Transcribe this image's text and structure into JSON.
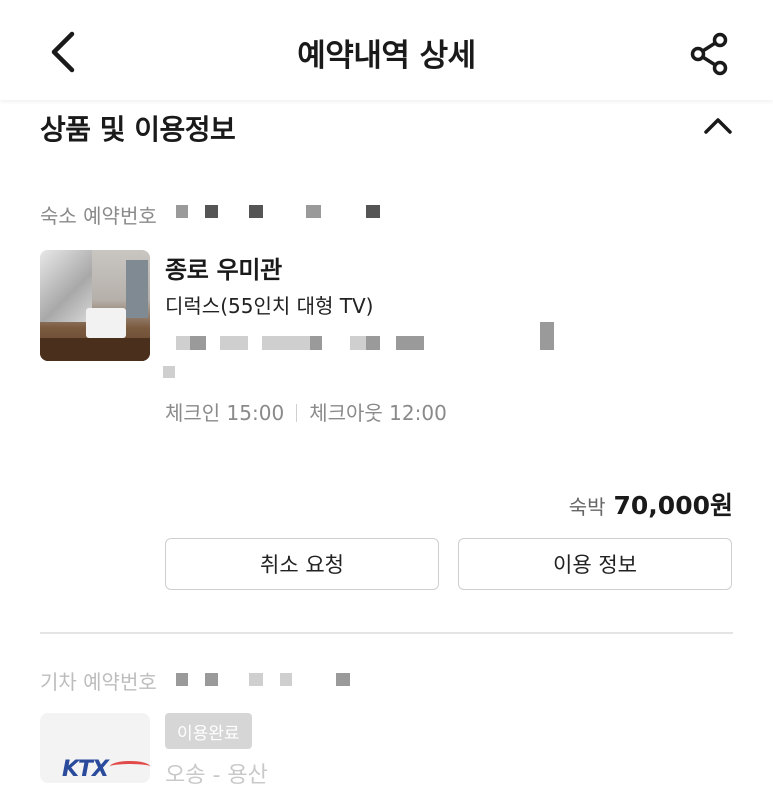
{
  "header": {
    "title": "예약내역 상세",
    "back_icon": "chevron-left-icon",
    "share_icon": "share-icon"
  },
  "section": {
    "title": "상품 및 이용정보",
    "toggle_icon": "chevron-up-icon"
  },
  "lodging": {
    "reservation_label": "숙소 예약번호",
    "name": "종로 우미관",
    "room_type": "디럭스(55인치 대형 TV)",
    "checkin": "체크인 15:00",
    "checkout": "체크아웃 12:00",
    "price_label": "숙박",
    "price_value": "70,000원",
    "cancel_button": "취소 요청",
    "info_button": "이용 정보"
  },
  "train": {
    "reservation_label": "기차 예약번호",
    "logo_text": "KTX",
    "status_badge": "이용완료",
    "route": "오송 - 용산"
  }
}
